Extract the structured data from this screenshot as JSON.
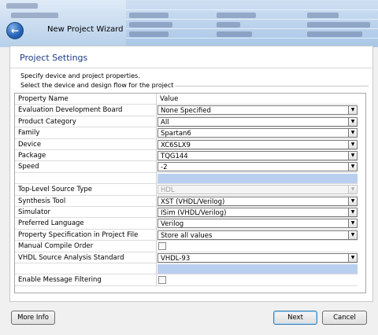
{
  "window": {
    "title": "New Project Wizard",
    "back_label": "←"
  },
  "page": {
    "title": "Project Settings",
    "description": "Specify device and project properties.",
    "group_label": "Select the device and design flow for the project"
  },
  "table": {
    "header_name": "Property Name",
    "header_value": "Value",
    "rows": [
      {
        "name": "Evaluation Development Board",
        "value": "None Specified",
        "type": "combo"
      },
      {
        "name": "Product Category",
        "value": "All",
        "type": "combo"
      },
      {
        "name": "Family",
        "value": "Spartan6",
        "type": "combo"
      },
      {
        "name": "Device",
        "value": "XC6SLX9",
        "type": "combo"
      },
      {
        "name": "Package",
        "value": "TQG144",
        "type": "combo"
      },
      {
        "name": "Speed",
        "value": "-2",
        "type": "combo"
      },
      {
        "name": "",
        "value": "",
        "type": "blank"
      },
      {
        "name": "Top-Level Source Type",
        "value": "HDL",
        "type": "disabled"
      },
      {
        "name": "Synthesis Tool",
        "value": "XST (VHDL/Verilog)",
        "type": "combo"
      },
      {
        "name": "Simulator",
        "value": "ISim (VHDL/Verilog)",
        "type": "combo"
      },
      {
        "name": "Preferred Language",
        "value": "Verilog",
        "type": "combo"
      },
      {
        "name": "Property Specification in Project File",
        "value": "Store all values",
        "type": "combo"
      },
      {
        "name": "Manual Compile Order",
        "value": "",
        "type": "checkbox"
      },
      {
        "name": "VHDL Source Analysis Standard",
        "value": "VHDL-93",
        "type": "combo"
      },
      {
        "name": "",
        "value": "",
        "type": "blank"
      },
      {
        "name": "Enable Message Filtering",
        "value": "",
        "type": "checkbox"
      }
    ]
  },
  "buttons": {
    "more_info": "More Info",
    "next": "Next",
    "cancel": "Cancel"
  },
  "colors": {
    "title_blue": "#1c3a8a",
    "selection_blue": "#b9cfef"
  },
  "icons": {
    "back": "back-arrow-icon",
    "dropdown": "chevron-down-icon"
  }
}
